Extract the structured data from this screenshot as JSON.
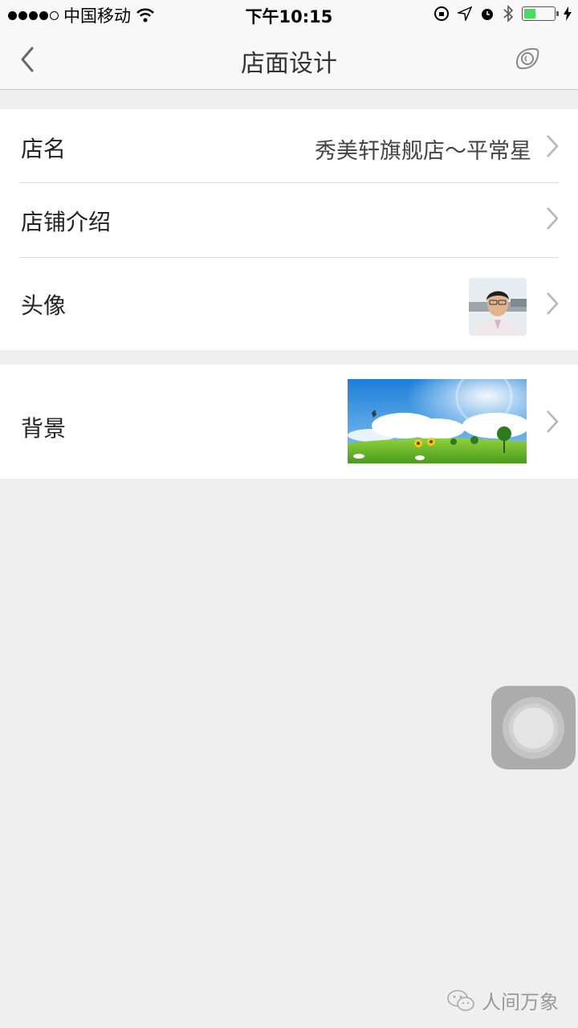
{
  "status_bar": {
    "carrier": "中国移动",
    "time": "下午10:15",
    "battery_level": 0.35
  },
  "nav": {
    "title": "店面设计"
  },
  "settings": {
    "store_name": {
      "label": "店名",
      "value": "秀美轩旗舰店～平常星"
    },
    "store_intro": {
      "label": "店铺介绍"
    },
    "avatar": {
      "label": "头像"
    },
    "background": {
      "label": "背景"
    }
  },
  "watermark": {
    "text": "人间万象"
  },
  "colors": {
    "battery": "#4cd964",
    "background": "#efefef",
    "row": "#ffffff"
  },
  "icons": [
    "back-icon",
    "eye-icon",
    "chevron-right-icon",
    "wifi-icon",
    "bluetooth-icon",
    "alarm-icon",
    "location-icon",
    "wechat-icon"
  ]
}
